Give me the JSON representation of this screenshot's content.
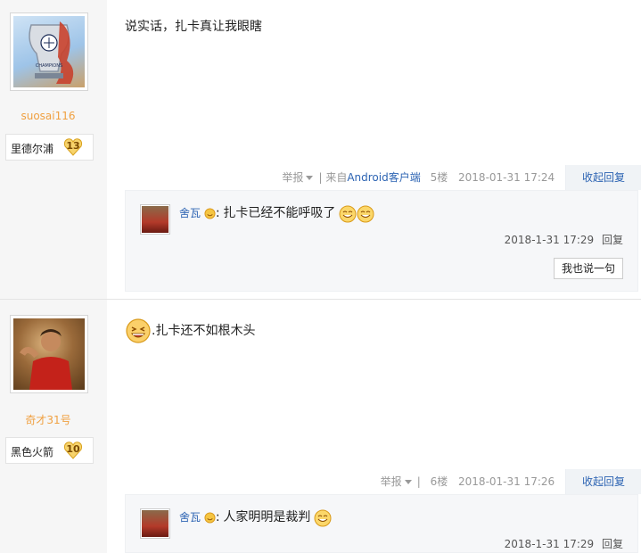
{
  "posts": [
    {
      "user": {
        "name": "suosai116",
        "badge_name": "里德尔浦",
        "badge_level": "13"
      },
      "content": "说实话，扎卡真让我眼瞎",
      "meta": {
        "report": "举报",
        "separator": "|",
        "source_prefix": "来自",
        "source": "Android客户端",
        "floor": "5楼",
        "date": "2018-01-31 17:24",
        "collapse": "收起回复"
      },
      "reply": {
        "name": "舍瓦",
        "sep": ":",
        "text": "扎卡已经不能呼吸了",
        "date": "2018-1-31 17:29",
        "reply_label": "回复",
        "say_button": "我也说一句"
      }
    },
    {
      "user": {
        "name": "奇才31号",
        "badge_name": "黑色火箭",
        "badge_level": "10"
      },
      "content": ".扎卡还不如根木头",
      "meta": {
        "report": "举报",
        "separator": "|",
        "floor": "6楼",
        "date": "2018-01-31 17:26",
        "collapse": "收起回复"
      },
      "reply": {
        "name": "舍瓦",
        "sep": ":",
        "text": "人家明明是裁判",
        "date": "2018-1-31 17:29",
        "reply_label": "回复"
      }
    }
  ],
  "colors": {
    "link": "#2d64b3",
    "username": "#f0a040",
    "sidebar": "#f6f6f6"
  }
}
